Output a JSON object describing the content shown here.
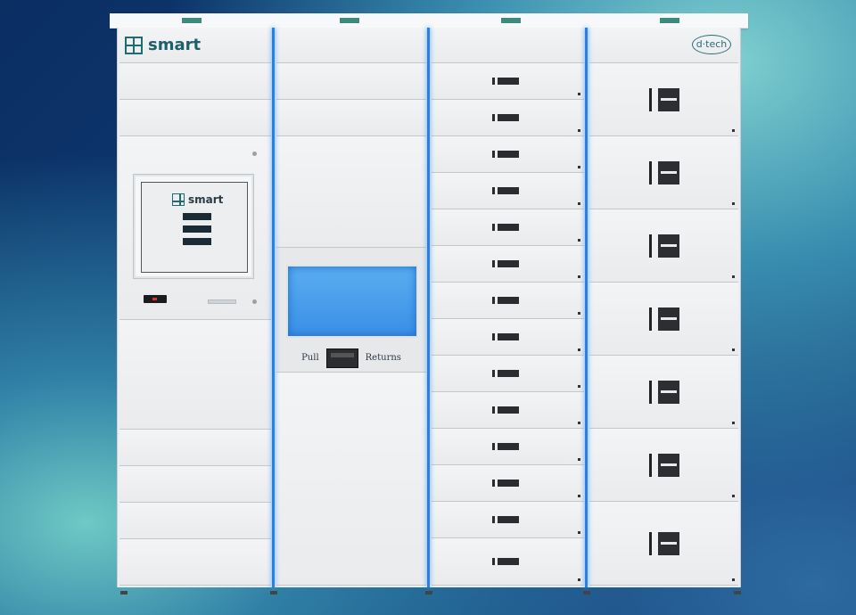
{
  "brand": {
    "logo_text": "smart",
    "partner_logo": "d·tech"
  },
  "kiosk_screen": {
    "logo_text": "smart",
    "buttons": [
      "",
      "",
      ""
    ]
  },
  "returns_bay": {
    "left_label": "Pull",
    "right_label": "Returns"
  },
  "colors": {
    "accent_blue": "#2c7fe0",
    "cabinet": "#eceef0",
    "brand_teal": "#1d6b73"
  }
}
